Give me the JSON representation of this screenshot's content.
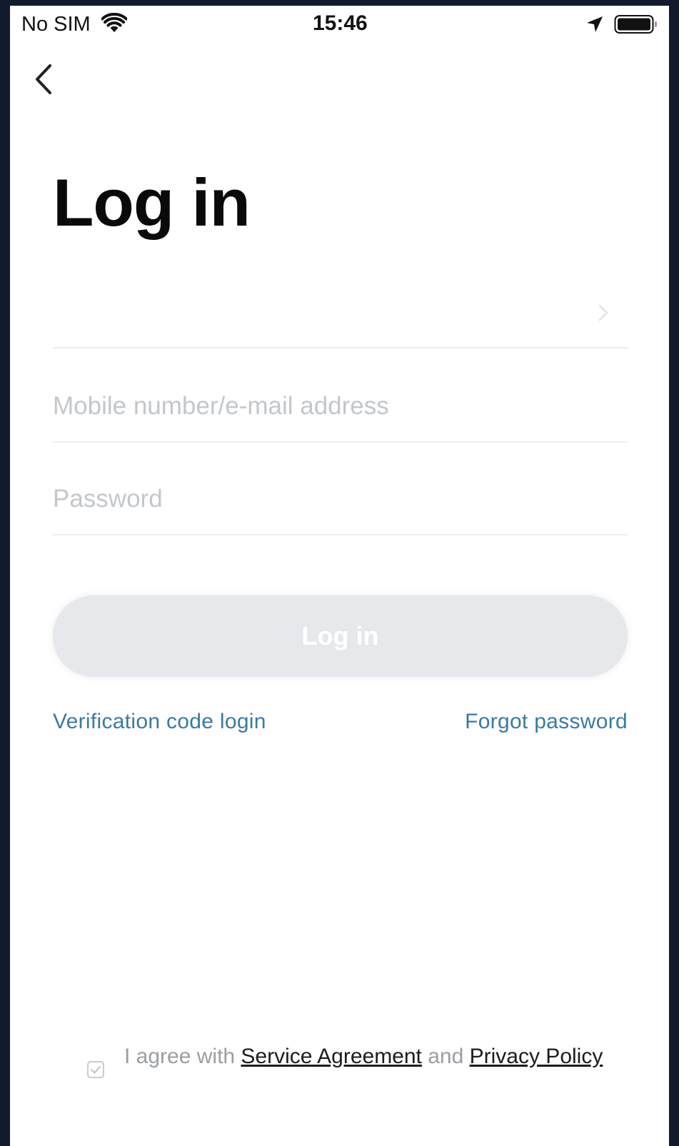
{
  "status_bar": {
    "carrier": "No SIM",
    "time": "15:46"
  },
  "page": {
    "title": "Log in"
  },
  "form": {
    "email_placeholder": "Mobile number/e-mail address",
    "password_placeholder": "Password",
    "login_button": "Log in"
  },
  "links": {
    "verification_login": "Verification code login",
    "forgot_password": "Forgot password"
  },
  "agreement": {
    "prefix": "I agree with ",
    "service_agreement": "Service Agreement",
    "middle": " and ",
    "privacy_policy": "Privacy Policy",
    "checked": true
  },
  "colors": {
    "link": "#3a7aa2",
    "button_disabled": "#e6e8ec",
    "frame_background": "#121a2e"
  }
}
